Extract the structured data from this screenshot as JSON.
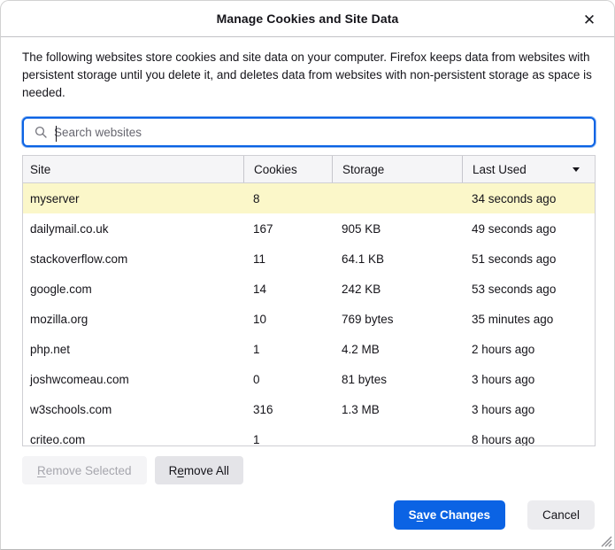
{
  "dialog": {
    "title": "Manage Cookies and Site Data",
    "close_glyph": "✕"
  },
  "description": "The following websites store cookies and site data on your computer. Firefox keeps data from websites with persistent storage until you delete it, and deletes data from websites with non-persistent storage as space is needed.",
  "search": {
    "placeholder": "Search websites",
    "value": ""
  },
  "table": {
    "columns": [
      "Site",
      "Cookies",
      "Storage",
      "Last Used"
    ],
    "sort_column": "Last Used",
    "sort_direction": "descending",
    "rows": [
      {
        "site": "myserver",
        "cookies": "8",
        "storage": "",
        "last_used": "34 seconds ago",
        "highlighted": true
      },
      {
        "site": "dailymail.co.uk",
        "cookies": "167",
        "storage": "905 KB",
        "last_used": "49 seconds ago",
        "highlighted": false
      },
      {
        "site": "stackoverflow.com",
        "cookies": "11",
        "storage": "64.1 KB",
        "last_used": "51 seconds ago",
        "highlighted": false
      },
      {
        "site": "google.com",
        "cookies": "14",
        "storage": "242 KB",
        "last_used": "53 seconds ago",
        "highlighted": false
      },
      {
        "site": "mozilla.org",
        "cookies": "10",
        "storage": "769 bytes",
        "last_used": "35 minutes ago",
        "highlighted": false
      },
      {
        "site": "php.net",
        "cookies": "1",
        "storage": "4.2 MB",
        "last_used": "2 hours ago",
        "highlighted": false
      },
      {
        "site": "joshwcomeau.com",
        "cookies": "0",
        "storage": "81 bytes",
        "last_used": "3 hours ago",
        "highlighted": false
      },
      {
        "site": "w3schools.com",
        "cookies": "316",
        "storage": "1.3 MB",
        "last_used": "3 hours ago",
        "highlighted": false
      },
      {
        "site": "criteo.com",
        "cookies": "1",
        "storage": "",
        "last_used": "8 hours ago",
        "highlighted": false
      }
    ]
  },
  "buttons": {
    "remove_selected": {
      "pre": "",
      "key": "R",
      "post": "emove Selected",
      "enabled": false
    },
    "remove_all": {
      "pre": "R",
      "key": "e",
      "post": "move All",
      "enabled": true
    },
    "save_changes": {
      "pre": "S",
      "key": "a",
      "post": "ve Changes"
    },
    "cancel": {
      "label": "Cancel"
    }
  },
  "colors": {
    "accent_blue": "#0b63e4",
    "highlight_yellow": "#fbf7c9",
    "header_bg": "#f5f5f7",
    "table_border": "#cfcfd4"
  }
}
